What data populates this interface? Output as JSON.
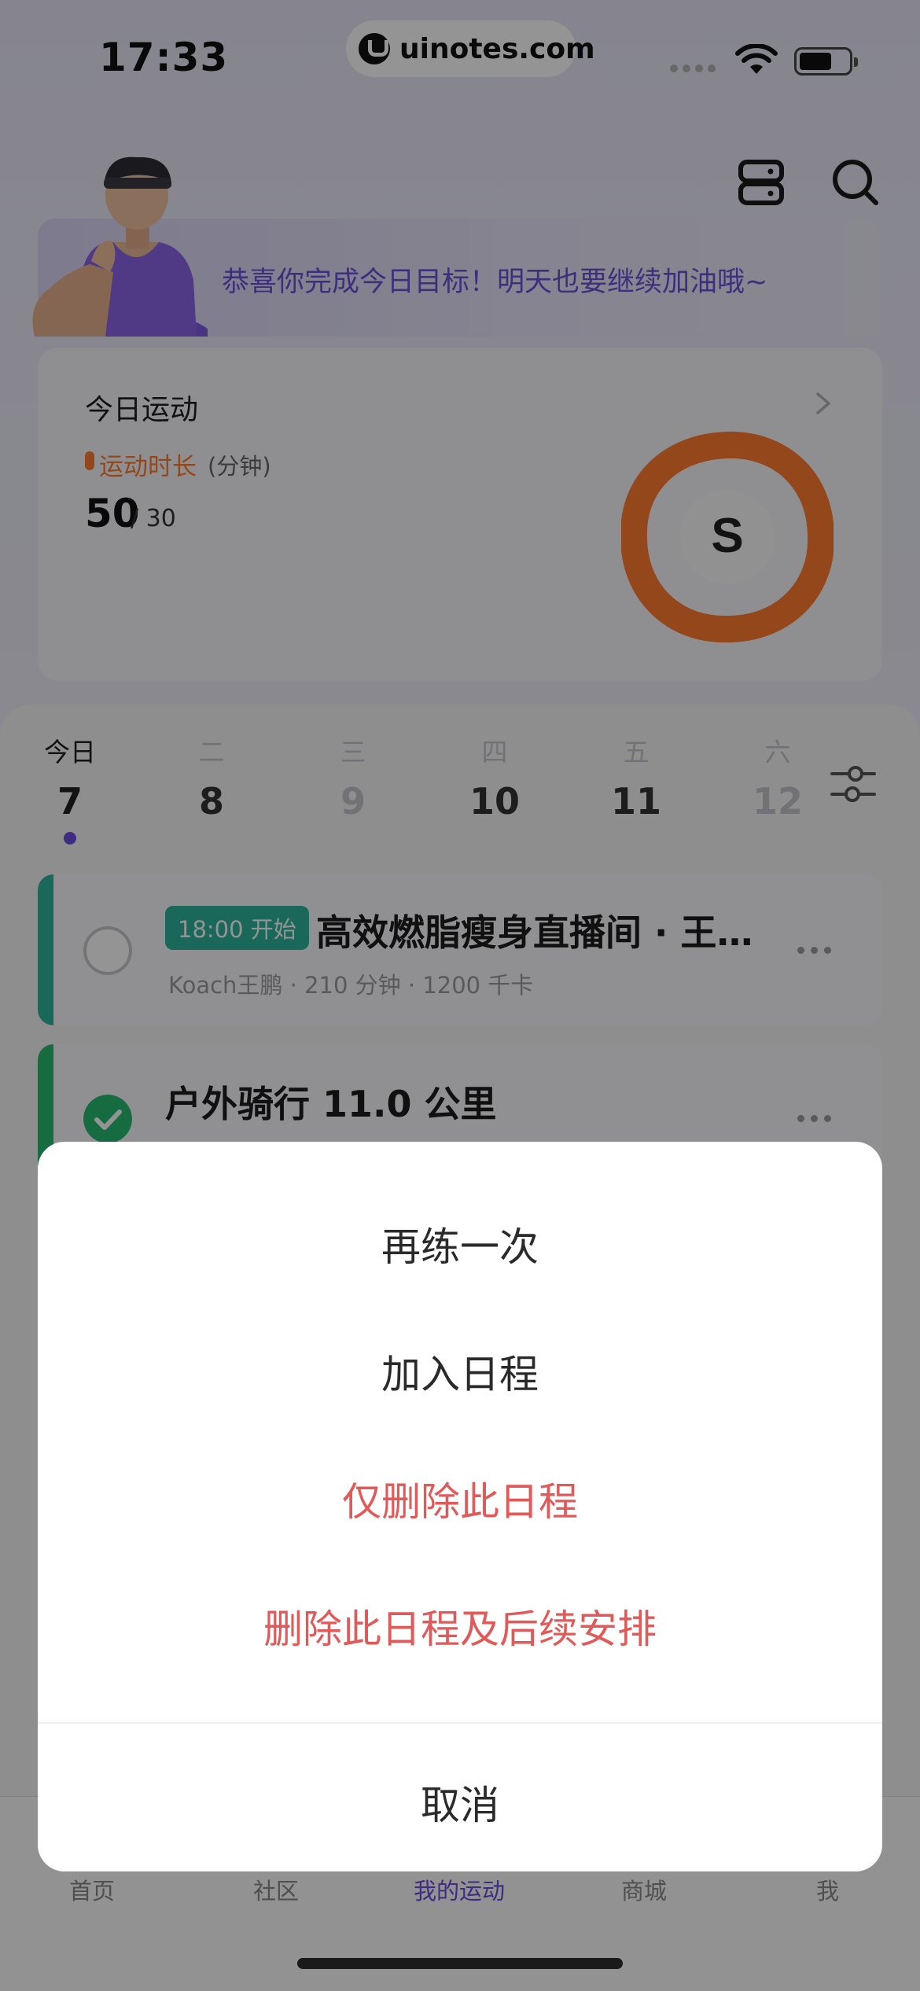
{
  "status_bar": {
    "time": "17:33",
    "url": "uinotes.com"
  },
  "header": {
    "icons": [
      "schedule-icon",
      "search-icon"
    ]
  },
  "banner": {
    "message": "恭喜你完成今日目标！明天也要继续加油哦~"
  },
  "today_card": {
    "title": "今日运动",
    "metric_label": "运动时长",
    "metric_unit": "(分钟)",
    "value": "50",
    "goal": "/ 30",
    "ring_letter": "S",
    "ring_progress_fraction": 1.0
  },
  "calendar": {
    "days": [
      {
        "label": "今日",
        "num": "7"
      },
      {
        "label": "二",
        "num": "8"
      },
      {
        "label": "三",
        "num": "9"
      },
      {
        "label": "四",
        "num": "10"
      },
      {
        "label": "五",
        "num": "11"
      },
      {
        "label": "六",
        "num": "12"
      }
    ]
  },
  "schedule": [
    {
      "tag": "18:00 开始",
      "title": "高效燃脂瘦身直播间 · 王…",
      "sub": "Koach王鹏 · 210 分钟 · 1200 千卡"
    },
    {
      "title": "户外骑行 11.0 公里"
    }
  ],
  "tabs": [
    "首页",
    "社区",
    "我的运动",
    "商城",
    "我"
  ],
  "action_sheet": {
    "options": [
      "再练一次",
      "加入日程",
      "仅删除此日程",
      "删除此日程及后续安排"
    ],
    "cancel": "取消"
  },
  "colors": {
    "accent": "#6d4ae0",
    "danger": "#e05a5a",
    "orange": "#ff7a2e",
    "teal": "#2bb39a",
    "green": "#27b86f"
  }
}
